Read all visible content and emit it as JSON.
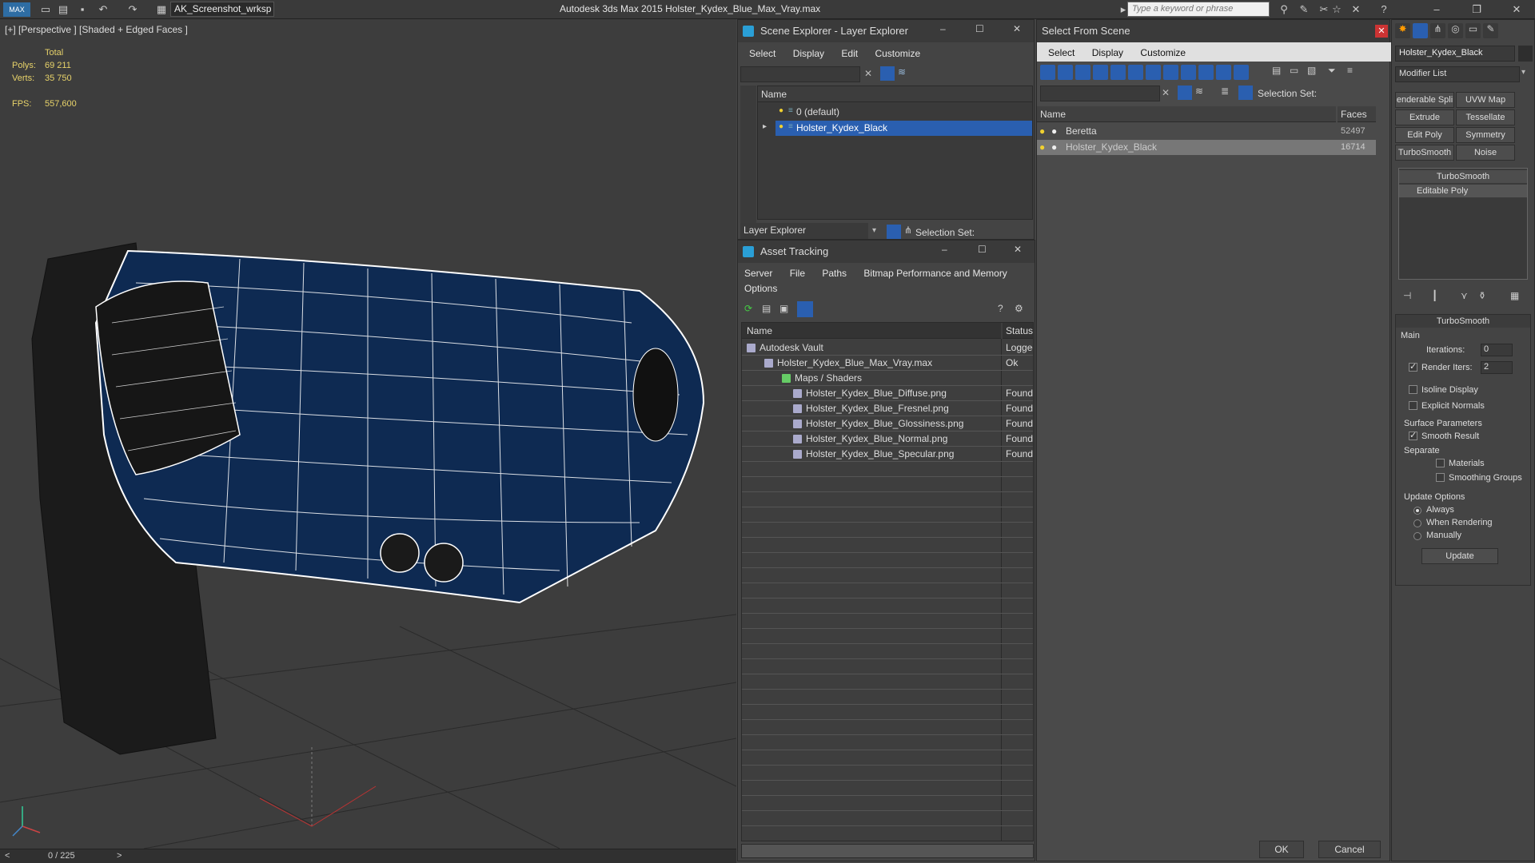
{
  "app": {
    "title": "Autodesk 3ds Max  2015     Holster_Kydex_Blue_Max_Vray.max",
    "workspace": "AK_Screenshot_wrksp",
    "search_placeholder": "Type a keyword or phrase"
  },
  "viewport": {
    "label": "[+] [Perspective ] [Shaded + Edged Faces ]",
    "stats": {
      "total_label": "Total",
      "polys_label": "Polys:",
      "polys": "69 211",
      "verts_label": "Verts:",
      "verts": "35 750",
      "fps_label": "FPS:",
      "fps": "557,600"
    },
    "timeline": {
      "frame": "0 / 225",
      "prev": "<",
      "next": ">"
    }
  },
  "layer_explorer": {
    "title": "Scene Explorer - Layer Explorer",
    "menu": [
      "Select",
      "Display",
      "Edit",
      "Customize"
    ],
    "column": "Name",
    "rows": [
      "0 (default)",
      "Holster_Kydex_Black"
    ],
    "footer_label": "Layer Explorer",
    "selection_set": "Selection Set:"
  },
  "asset_tracking": {
    "title": "Asset Tracking",
    "menu": [
      "Server",
      "File",
      "Paths",
      "Bitmap Performance and Memory"
    ],
    "menu2": "Options",
    "col_name": "Name",
    "col_status": "Status",
    "rows": [
      {
        "name": "Autodesk Vault",
        "status": "Logged"
      },
      {
        "name": "Holster_Kydex_Blue_Max_Vray.max",
        "status": "Ok"
      },
      {
        "name": "Maps / Shaders",
        "status": ""
      },
      {
        "name": "Holster_Kydex_Blue_Diffuse.png",
        "status": "Found"
      },
      {
        "name": "Holster_Kydex_Blue_Fresnel.png",
        "status": "Found"
      },
      {
        "name": "Holster_Kydex_Blue_Glossiness.png",
        "status": "Found"
      },
      {
        "name": "Holster_Kydex_Blue_Normal.png",
        "status": "Found"
      },
      {
        "name": "Holster_Kydex_Blue_Specular.png",
        "status": "Found"
      }
    ]
  },
  "select_from_scene": {
    "title": "Select From Scene",
    "menu": [
      "Select",
      "Display",
      "Customize"
    ],
    "selection_set": "Selection Set:",
    "col_name": "Name",
    "col_faces": "Faces",
    "rows": [
      {
        "name": "Beretta",
        "faces": "52497"
      },
      {
        "name": "Holster_Kydex_Black",
        "faces": "16714"
      }
    ],
    "ok": "OK",
    "cancel": "Cancel"
  },
  "command_panel": {
    "object_name": "Holster_Kydex_Black",
    "modifier_list": "Modifier List",
    "buttons": [
      "enderable Spli",
      "UVW Map",
      "Extrude",
      "Tessellate",
      "Edit Poly",
      "Symmetry",
      "TurboSmooth",
      "Noise"
    ],
    "stack": [
      "TurboSmooth",
      "Editable Poly"
    ],
    "rollout_title": "TurboSmooth",
    "main_label": "Main",
    "iterations_label": "Iterations:",
    "iterations": "0",
    "render_iters_label": "Render Iters:",
    "render_iters": "2",
    "isoline": "Isoline Display",
    "explicit_normals": "Explicit Normals",
    "surface_params": "Surface Parameters",
    "smooth_result": "Smooth Result",
    "separate": "Separate",
    "materials": "Materials",
    "smoothing_groups": "Smoothing Groups",
    "update_options": "Update Options",
    "always": "Always",
    "when_rendering": "When Rendering",
    "manually": "Manually",
    "update": "Update"
  },
  "colors": {
    "selection": "#2a5fb0",
    "holster": "#0e2a52",
    "wire": "#ffffff",
    "stats": "#e8d36a"
  }
}
